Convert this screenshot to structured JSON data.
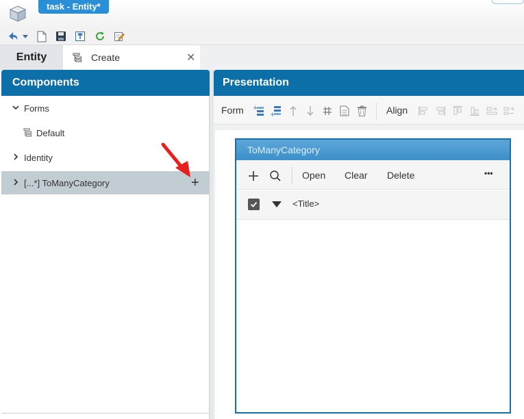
{
  "app": {
    "title": "task - Entity*"
  },
  "tabs": {
    "entity_label": "Entity",
    "create_label": "Create"
  },
  "left_panel": {
    "title": "Components",
    "items": [
      {
        "label": "Forms",
        "expanded": true
      },
      {
        "label": "Default"
      },
      {
        "label": "Identity",
        "expanded": false
      },
      {
        "label": "[...*] ToManyCategory",
        "expanded": false,
        "selected": true,
        "action": "+"
      }
    ]
  },
  "right_panel": {
    "title": "Presentation",
    "toolbar": {
      "form_label": "Form",
      "align_label": "Align"
    }
  },
  "widget": {
    "title": "ToManyCategory",
    "buttons": {
      "open": "Open",
      "clear": "Clear",
      "delete": "Delete",
      "more": "•••"
    },
    "row": {
      "title": "<Title>",
      "checked": true
    }
  },
  "colors": {
    "header_blue": "#0d6fa8",
    "title_tab_blue": "#2a8fd6",
    "selected_row": "#c1ccd3",
    "arrow_red": "#e8201c"
  },
  "icons": [
    "app-cube-icon",
    "undo-icon",
    "new-document-icon",
    "save-icon",
    "export-icon",
    "refresh-icon",
    "edit-icon",
    "search-icon",
    "add-icon",
    "checkbox-icon"
  ]
}
